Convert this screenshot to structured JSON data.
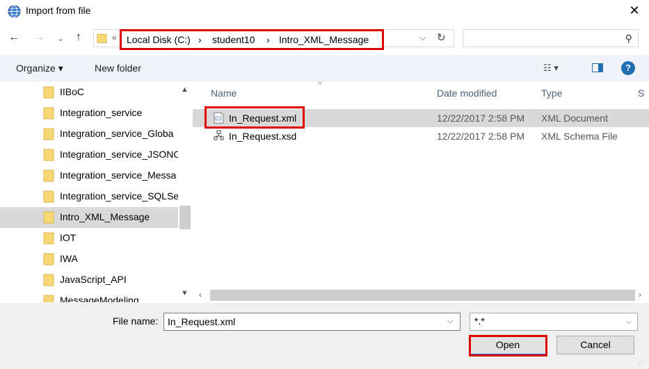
{
  "window": {
    "title": "Import from file",
    "icon": "globe-icon",
    "close_glyph": "✕"
  },
  "address": {
    "overflow": "«",
    "breadcrumbs": [
      "Local Disk (C:)",
      "student10",
      "Intro_XML_Message"
    ],
    "separator": "›",
    "search_placeholder": ""
  },
  "toolbar": {
    "organize_label": "Organize ▾",
    "new_folder_label": "New folder",
    "help_label": "?"
  },
  "nav_pane": {
    "items": [
      {
        "label": "IIBoC"
      },
      {
        "label": "Integration_service"
      },
      {
        "label": "Integration_service_Globa"
      },
      {
        "label": "Integration_service_JSONC"
      },
      {
        "label": "Integration_service_Messa"
      },
      {
        "label": "Integration_service_SQLSe"
      },
      {
        "label": "Intro_XML_Message",
        "selected": true
      },
      {
        "label": "IOT"
      },
      {
        "label": "IWA"
      },
      {
        "label": "JavaScript_API"
      },
      {
        "label": "MessageModeling"
      }
    ]
  },
  "file_list": {
    "columns": [
      "Name",
      "Date modified",
      "Type",
      "S"
    ],
    "files": [
      {
        "name": "In_Request.xml",
        "date": "12/22/2017 2:58 PM",
        "type": "XML Document",
        "selected": true,
        "icon": "xml-file-icon"
      },
      {
        "name": "In_Request.xsd",
        "date": "12/22/2017 2:58 PM",
        "type": "XML Schema File",
        "selected": false,
        "icon": "xsd-schema-icon"
      }
    ]
  },
  "bottom": {
    "file_name_label": "File name:",
    "file_name_value": "In_Request.xml",
    "filter_value": "*.*",
    "open_label": "Open",
    "cancel_label": "Cancel"
  },
  "colors": {
    "highlight_red": "#e00000",
    "selection_gray": "#d9d9d9",
    "folder_yellow": "#f8d775",
    "accent_blue": "#0078d7"
  }
}
